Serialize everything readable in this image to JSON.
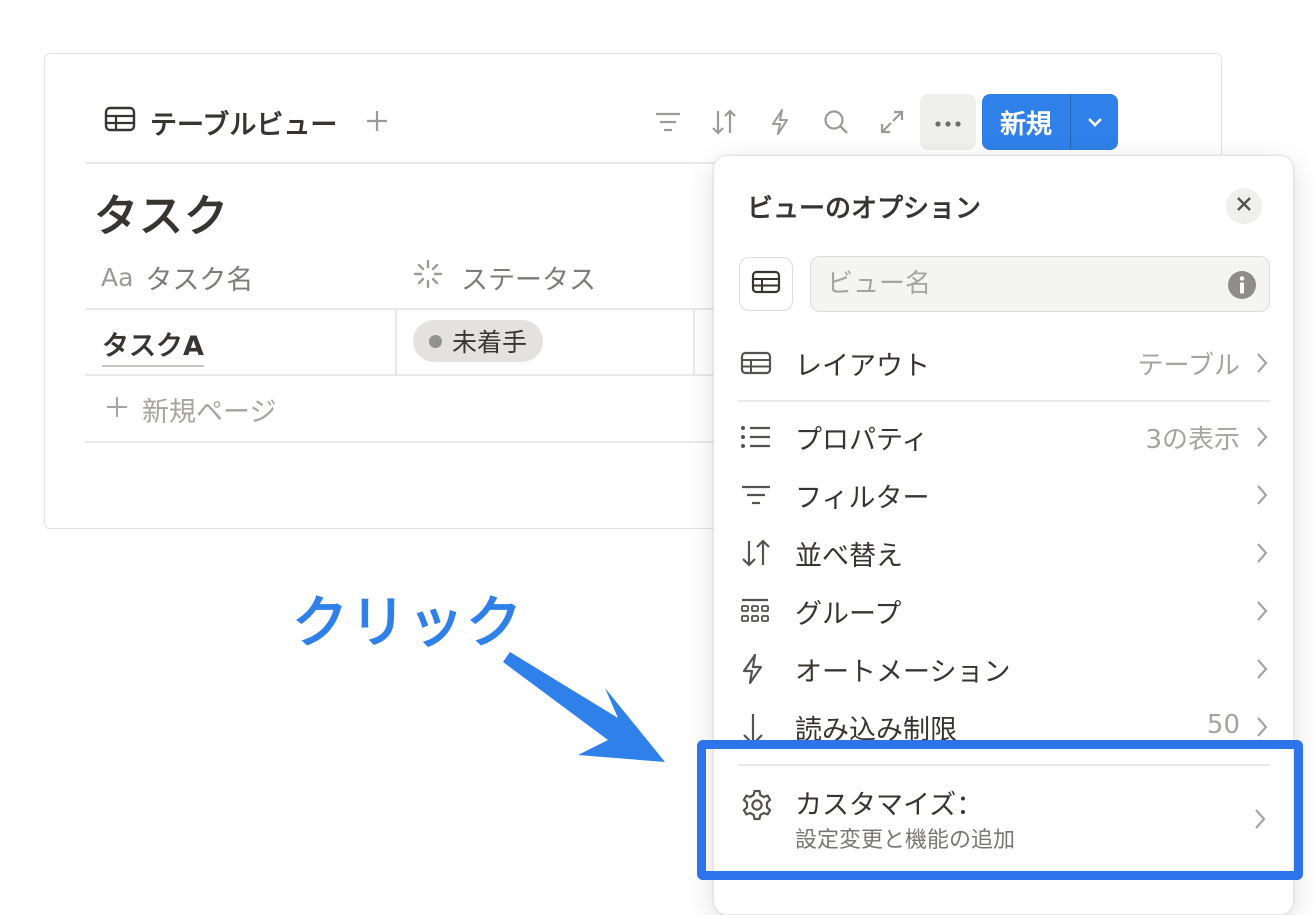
{
  "toolbar": {
    "view_tab_label": "テーブルビュー",
    "new_button_label": "新規"
  },
  "database": {
    "title": "タスク",
    "columns": [
      "タスク名",
      "ステータス"
    ],
    "name_column_prefix": "Aa",
    "rows": [
      {
        "name": "タスクA",
        "status": "未着手"
      }
    ],
    "new_page_label": "新規ページ"
  },
  "panel": {
    "title": "ビューのオプション",
    "view_name_placeholder": "ビュー名",
    "items": [
      {
        "label": "レイアウト",
        "value": "テーブル",
        "icon": "table-icon"
      },
      {
        "label": "プロパティ",
        "value": "3の表示",
        "icon": "list-icon"
      },
      {
        "label": "フィルター",
        "value": "",
        "icon": "filter-icon"
      },
      {
        "label": "並べ替え",
        "value": "",
        "icon": "sort-icon"
      },
      {
        "label": "グループ",
        "value": "",
        "icon": "group-icon"
      },
      {
        "label": "オートメーション",
        "value": "",
        "icon": "lightning-icon"
      },
      {
        "label": "読み込み制限",
        "value": "50",
        "icon": "arrow-down-icon"
      }
    ],
    "customize": {
      "label": "カスタマイズ：",
      "sublabel": "設定変更と機能の追加",
      "icon": "gear-icon"
    }
  },
  "annotation": {
    "label": "クリック",
    "color": "#2f80e8"
  },
  "colors": {
    "accent": "#2f80e8",
    "highlight_border": "#2d73ea"
  }
}
